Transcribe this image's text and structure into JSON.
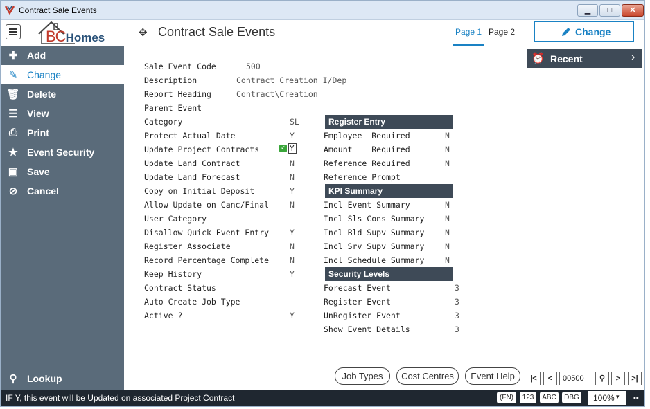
{
  "window": {
    "title": "Contract Sale Events"
  },
  "header": {
    "logo_text": "Homes",
    "logo_prefix": "BC",
    "heading": "Contract Sale Events",
    "tabs": [
      {
        "label": "Page 1"
      },
      {
        "label": "Page 2"
      }
    ],
    "change_label": "Change"
  },
  "sidebar": {
    "items": [
      {
        "label": "Add",
        "icon": "plus-icon"
      },
      {
        "label": "Change",
        "icon": "pencil-icon"
      },
      {
        "label": "Delete",
        "icon": "trash-icon"
      },
      {
        "label": "View",
        "icon": "list-icon"
      },
      {
        "label": "Print",
        "icon": "printer-icon"
      },
      {
        "label": "Event Security",
        "icon": "star-icon"
      },
      {
        "label": "Save",
        "icon": "floppy-icon"
      },
      {
        "label": "Cancel",
        "icon": "cancel-icon"
      }
    ],
    "lookup_label": "Lookup"
  },
  "recent": {
    "label": "Recent"
  },
  "form": {
    "sale_event_code": {
      "label": "Sale Event Code",
      "value": "500"
    },
    "description": {
      "label": "Description",
      "value": "Contract Creation I/Dep"
    },
    "report_heading": {
      "label": "Report Heading",
      "value": "Contract\\Creation"
    },
    "parent_event": {
      "label": "Parent Event",
      "value": ""
    },
    "category": {
      "label": "Category",
      "value": "SL"
    },
    "protect_actual_date": {
      "label": "Protect Actual Date",
      "value": "Y"
    },
    "update_project_contracts": {
      "label": "Update Project Contracts",
      "value": "Y"
    },
    "update_land_contract": {
      "label": "Update Land Contract",
      "value": "N"
    },
    "update_land_forecast": {
      "label": "Update Land Forecast",
      "value": "N"
    },
    "copy_on_initial_deposit": {
      "label": "Copy on Initial Deposit",
      "value": "Y"
    },
    "allow_update_on_canc": {
      "label": "Allow Update on Canc/Final",
      "value": "N"
    },
    "user_category": {
      "label": "User Category",
      "value": ""
    },
    "disallow_quick_event_entry": {
      "label": "Disallow Quick Event Entry",
      "value": "Y"
    },
    "register_associate": {
      "label": "Register Associate",
      "value": "N"
    },
    "record_percentage_complete": {
      "label": "Record Percentage Complete",
      "value": "N"
    },
    "keep_history": {
      "label": "Keep History",
      "value": "Y"
    },
    "contract_status": {
      "label": "Contract Status",
      "value": ""
    },
    "auto_create_job_type": {
      "label": "Auto Create Job Type",
      "value": ""
    },
    "active": {
      "label": "Active ?",
      "value": "Y"
    }
  },
  "register_entry": {
    "title": "Register Entry",
    "rows": [
      {
        "label": "Employee  Required",
        "value": "N"
      },
      {
        "label": "Amount    Required",
        "value": "N"
      },
      {
        "label": "Reference Required",
        "value": "N"
      },
      {
        "label": "Reference Prompt",
        "value": ""
      }
    ]
  },
  "kpi_summary": {
    "title": "KPI Summary",
    "rows": [
      {
        "label": "Incl Event Summary",
        "value": "N"
      },
      {
        "label": "Incl Sls Cons Summary",
        "value": "N"
      },
      {
        "label": "Incl Bld Supv Summary",
        "value": "N"
      },
      {
        "label": "Incl Srv Supv Summary",
        "value": "N"
      },
      {
        "label": "Incl Schedule Summary",
        "value": "N"
      }
    ]
  },
  "security_levels": {
    "title": "Security Levels",
    "rows": [
      {
        "label": "Forecast Event",
        "value": "3"
      },
      {
        "label": "Register Event",
        "value": "3"
      },
      {
        "label": "UnRegister Event",
        "value": "3"
      },
      {
        "label": "Show Event Details",
        "value": "3"
      }
    ]
  },
  "bottom_buttons": {
    "job_types": "Job Types",
    "cost_centres": "Cost Centres",
    "event_help": "Event Help"
  },
  "navigator": {
    "record_value": "00500"
  },
  "statusbar": {
    "message": "IF Y, this event will be Updated on associated Project Contract",
    "fn": "(FN)",
    "num": "123",
    "abc": "ABC",
    "dbg": "DBG",
    "zoom": "100%"
  },
  "colors": {
    "accent": "#1a82c4",
    "sidebar": "#5a6b7a",
    "section_header": "#3e4a57",
    "status_bar": "#1f2730"
  }
}
